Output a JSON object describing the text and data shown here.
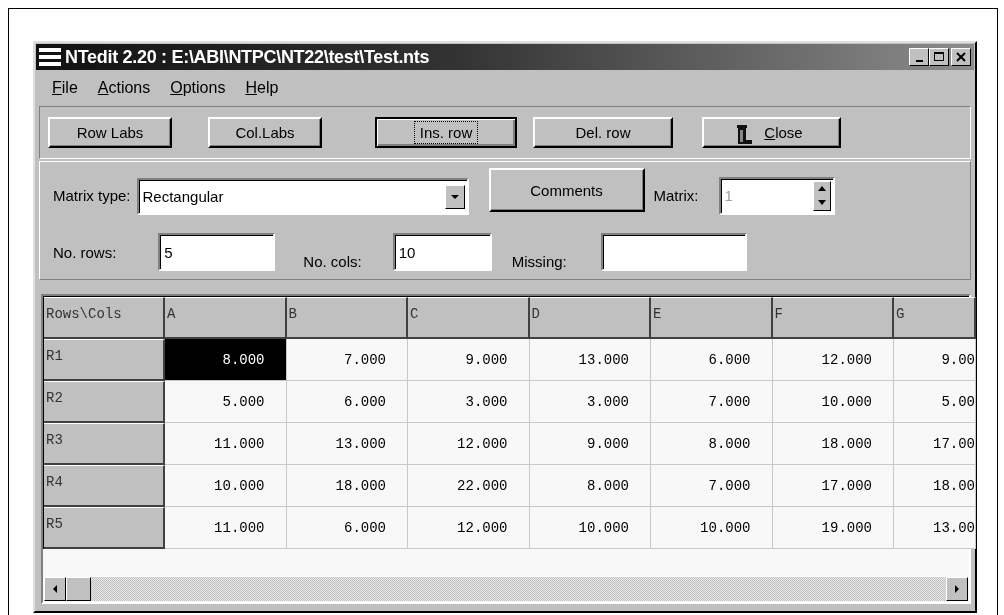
{
  "window": {
    "title": "NTedit 2.20 : E:\\ABI\\NTPC\\NT22\\test\\Test.nts"
  },
  "menu": [
    {
      "label": "File"
    },
    {
      "label": "Actions"
    },
    {
      "label": "Options"
    },
    {
      "label": "Help"
    }
  ],
  "toolbar": [
    {
      "label": "Row Labs",
      "focused": false,
      "kind": "text"
    },
    {
      "label": "Col.Labs",
      "focused": false,
      "kind": "text"
    },
    {
      "label": "Ins. row",
      "focused": true,
      "kind": "text"
    },
    {
      "label": "Del. row",
      "focused": false,
      "kind": "text"
    },
    {
      "label": "Close",
      "focused": false,
      "kind": "icon"
    }
  ],
  "form": {
    "matrix_type": {
      "label": "Matrix type:",
      "value": "Rectangular"
    },
    "comments_button": {
      "label": "Comments"
    },
    "matrix": {
      "label": "Matrix:",
      "value": "1",
      "disabled": true
    },
    "rows_field": {
      "label": "No. rows:",
      "value": "5"
    },
    "cols_field": {
      "label": "No. cols:",
      "value": "10"
    },
    "missing_field": {
      "label": "Missing:"
    }
  },
  "grid": {
    "corner": "Rows\\Cols",
    "columns": [
      "A",
      "B",
      "C",
      "D",
      "E",
      "F",
      "G"
    ],
    "rows": [
      {
        "label": "R1",
        "cells": [
          {
            "value": "8.000",
            "selected": true
          },
          {
            "value": "7.000",
            "selected": false
          },
          {
            "value": "9.000",
            "selected": false
          },
          {
            "value": "13.000",
            "selected": false
          },
          {
            "value": "6.000",
            "selected": false
          },
          {
            "value": "12.000",
            "selected": false
          },
          {
            "value": "9.00",
            "selected": false
          }
        ]
      },
      {
        "label": "R2",
        "cells": [
          {
            "value": "5.000",
            "selected": false
          },
          {
            "value": "6.000",
            "selected": false
          },
          {
            "value": "3.000",
            "selected": false
          },
          {
            "value": "3.000",
            "selected": false
          },
          {
            "value": "7.000",
            "selected": false
          },
          {
            "value": "10.000",
            "selected": false
          },
          {
            "value": "5.00",
            "selected": false
          }
        ]
      },
      {
        "label": "R3",
        "cells": [
          {
            "value": "11.000",
            "selected": false
          },
          {
            "value": "13.000",
            "selected": false
          },
          {
            "value": "12.000",
            "selected": false
          },
          {
            "value": "9.000",
            "selected": false
          },
          {
            "value": "8.000",
            "selected": false
          },
          {
            "value": "18.000",
            "selected": false
          },
          {
            "value": "17.00",
            "selected": false
          }
        ]
      },
      {
        "label": "R4",
        "cells": [
          {
            "value": "10.000",
            "selected": false
          },
          {
            "value": "18.000",
            "selected": false
          },
          {
            "value": "22.000",
            "selected": false
          },
          {
            "value": "8.000",
            "selected": false
          },
          {
            "value": "7.000",
            "selected": false
          },
          {
            "value": "17.000",
            "selected": false
          },
          {
            "value": "18.00",
            "selected": false
          }
        ]
      },
      {
        "label": "R5",
        "cells": [
          {
            "value": "11.000",
            "selected": false
          },
          {
            "value": "6.000",
            "selected": false
          },
          {
            "value": "12.000",
            "selected": false
          },
          {
            "value": "10.000",
            "selected": false
          },
          {
            "value": "10.000",
            "selected": false
          },
          {
            "value": "19.000",
            "selected": false
          },
          {
            "value": "13.00",
            "selected": false
          }
        ]
      }
    ]
  }
}
